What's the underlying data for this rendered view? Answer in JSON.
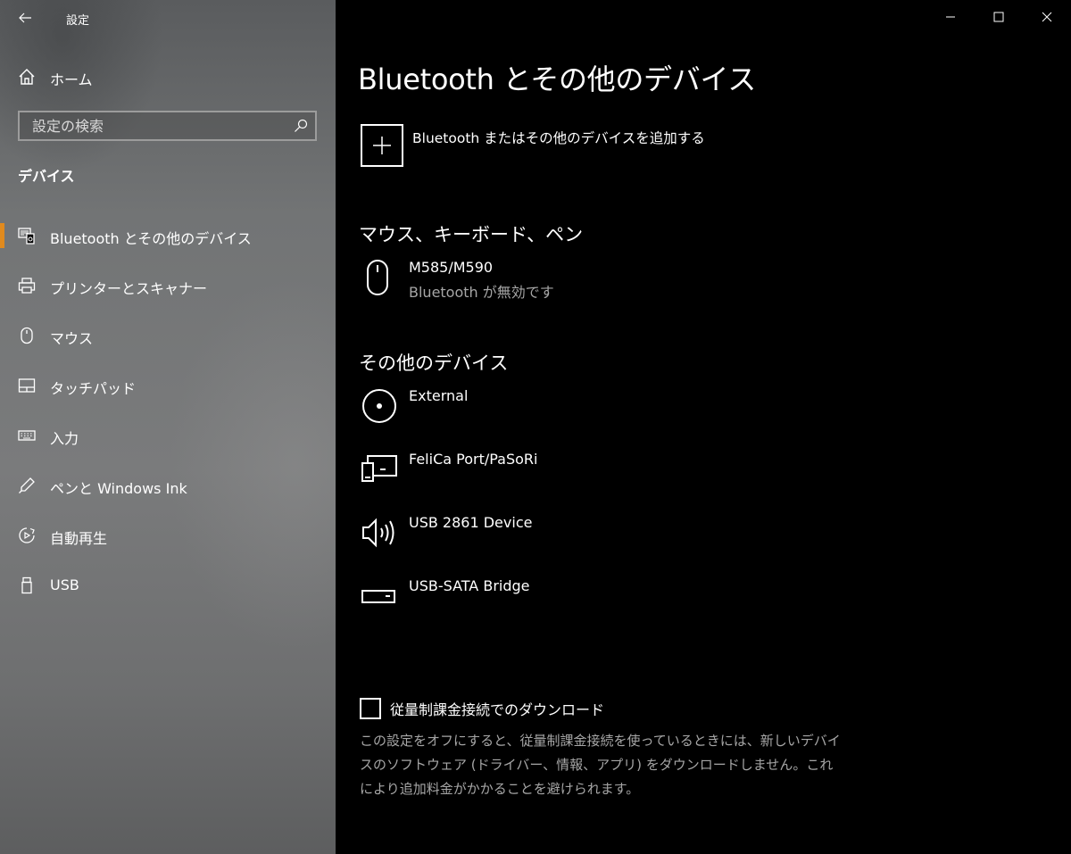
{
  "window": {
    "title": "設定",
    "controls": [
      "minimize",
      "maximize",
      "close"
    ]
  },
  "sidebar": {
    "home_label": "ホーム",
    "search": {
      "placeholder": "設定の検索"
    },
    "section_label": "デバイス",
    "items": [
      {
        "label": "Bluetooth とその他のデバイス",
        "icon": "bluetooth-devices-icon",
        "active": true
      },
      {
        "label": "プリンターとスキャナー",
        "icon": "printer-icon",
        "active": false
      },
      {
        "label": "マウス",
        "icon": "mouse-icon",
        "active": false
      },
      {
        "label": "タッチパッド",
        "icon": "touchpad-icon",
        "active": false
      },
      {
        "label": "入力",
        "icon": "keyboard-icon",
        "active": false
      },
      {
        "label": "ペンと Windows Ink",
        "icon": "pen-icon",
        "active": false
      },
      {
        "label": "自動再生",
        "icon": "autoplay-icon",
        "active": false
      },
      {
        "label": "USB",
        "icon": "usb-icon",
        "active": false
      }
    ],
    "accent_color": "#e08a1e"
  },
  "main": {
    "title": "Bluetooth とその他のデバイス",
    "add_device_label": "Bluetooth またはその他のデバイスを追加する",
    "groups": [
      {
        "heading": "マウス、キーボード、ペン",
        "devices": [
          {
            "name": "M585/M590",
            "status": "Bluetooth が無効です",
            "icon": "mouse-icon"
          }
        ]
      },
      {
        "heading": "その他のデバイス",
        "devices": [
          {
            "name": "External",
            "status": "",
            "icon": "disc-icon"
          },
          {
            "name": "FeliCa Port/PaSoRi",
            "status": "",
            "icon": "devices-icon"
          },
          {
            "name": "USB 2861 Device",
            "status": "",
            "icon": "speaker-icon"
          },
          {
            "name": "USB-SATA Bridge",
            "status": "",
            "icon": "drive-icon"
          }
        ]
      }
    ],
    "metered": {
      "checked": false,
      "label": "従量制課金接続でのダウンロード",
      "description": "この設定をオフにすると、従量制課金接続を使っているときには、新しいデバイスのソフトウェア (ドライバー、情報、アプリ) をダウンロードしません。これにより追加料金がかかることを避けられます。"
    }
  }
}
